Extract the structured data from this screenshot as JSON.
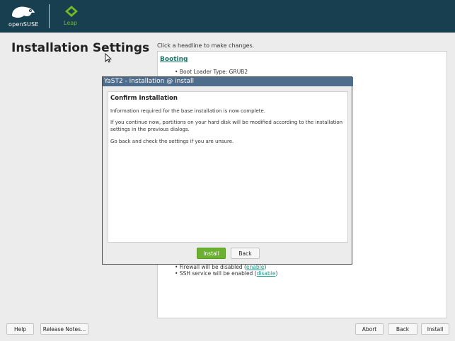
{
  "header": {
    "opensuse_text": "openSUSE",
    "leap_text": "Leap",
    "colors": {
      "bar": "#173f4f",
      "leap_green": "#73ba25"
    }
  },
  "page": {
    "title": "Installation Settings",
    "hint": "Click a headline to make changes."
  },
  "settings": {
    "booting_headline": "Booting",
    "boot_loader_line": "• Boot Loader Type: GRUB2",
    "firewall_prefix": "• Firewall will be disabled (",
    "firewall_link": "enable",
    "firewall_suffix": ")",
    "ssh_prefix": "• SSH service will be enabled (",
    "ssh_link": "disable",
    "ssh_suffix": ")"
  },
  "dialog": {
    "window_title": "YaST2 - installation @ install",
    "heading": "Confirm Installation",
    "para1": "Information required for the base installation is now complete.",
    "para2": "If you continue now, partitions on your hard disk will be modified according to the installation settings in the previous dialogs.",
    "para3": "Go back and check the settings if you are unsure.",
    "install_label": "Install",
    "back_label": "Back"
  },
  "footer": {
    "help_label": "Help",
    "release_notes_label": "Release Notes...",
    "abort_label": "Abort",
    "back_label": "Back",
    "install_label": "Install"
  }
}
